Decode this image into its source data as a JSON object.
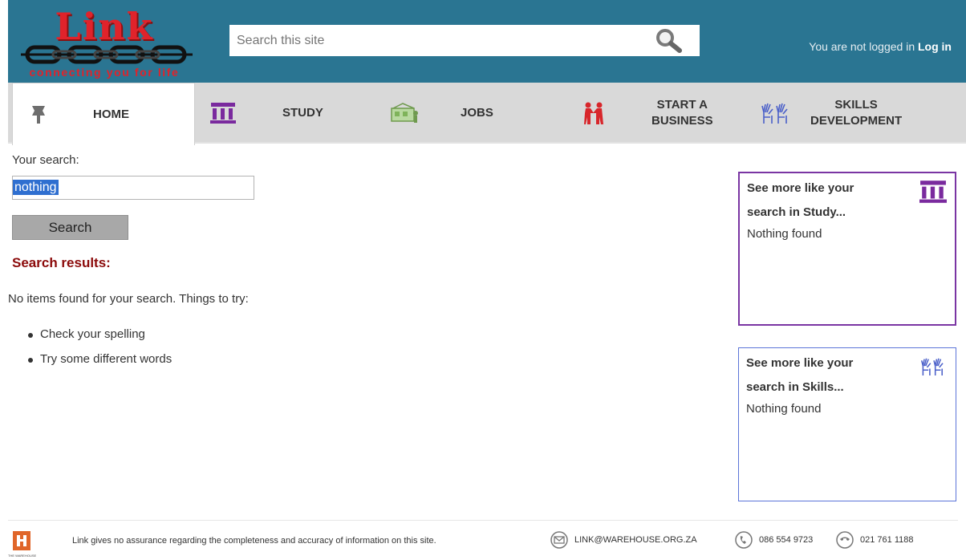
{
  "header": {
    "logo_word": "Link",
    "logo_tagline": "connecting you for life",
    "search_placeholder": "Search this site",
    "login_text": "You are not logged in",
    "login_link": "Log in"
  },
  "nav": {
    "items": [
      {
        "label": "HOME",
        "icon": "map-pin-icon",
        "active": true
      },
      {
        "label": "STUDY",
        "icon": "institution-icon"
      },
      {
        "label": "JOBS",
        "icon": "workers-icon"
      },
      {
        "label": "START A\nBUSINESS",
        "label_line1": "START A",
        "label_line2": "BUSINESS",
        "icon": "handshake-icon"
      },
      {
        "label_line1": "SKILLS",
        "label_line2": "DEVELOPMENT",
        "icon": "hands-icon"
      }
    ]
  },
  "main": {
    "your_search_label": "Your search:",
    "query_value": "nothing",
    "search_button": "Search",
    "results_heading": "Search results:",
    "no_results_text": "No items found for your search. Things to try:",
    "tips": [
      "Check your spelling",
      "Try some different words"
    ]
  },
  "side": {
    "study": {
      "title": "See more like your search in Study...",
      "text": "Nothing found",
      "icon": "institution-icon"
    },
    "skills": {
      "title": "See more like your search in Skills...",
      "text": "Nothing found",
      "icon": "hands-icon"
    }
  },
  "footer": {
    "logo_text": "THE WAREHOUSE",
    "disclaimer": "Link gives no assurance regarding the completeness and accuracy of information on this site.",
    "email": "LINK@WAREHOUSE.ORG.ZA",
    "phone": "086 554 9723",
    "fax": "021 761 1188"
  },
  "colors": {
    "header_bg": "#2a7592",
    "logo_red": "#e0232b",
    "heading_red": "#8b0a0a",
    "study_purple": "#7a35a3",
    "skills_blue": "#5b74d8"
  }
}
